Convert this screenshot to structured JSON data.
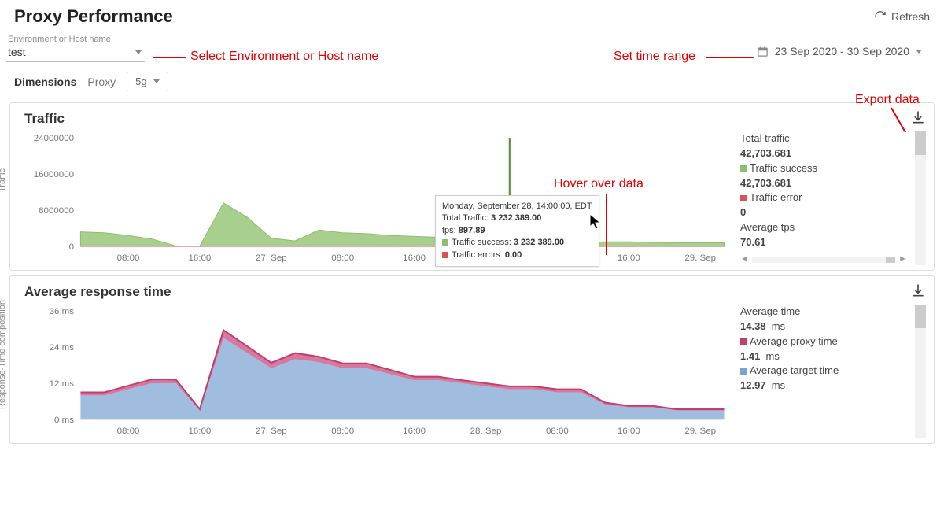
{
  "page": {
    "title": "Proxy Performance",
    "refresh": "Refresh"
  },
  "filters": {
    "env_label": "Environment or Host name",
    "env_value": "test",
    "date_range": "23 Sep 2020 - 30 Sep 2020"
  },
  "dimensions": {
    "label": "Dimensions",
    "proxy_label": "Proxy",
    "proxy_value": "5g"
  },
  "annotations": {
    "env": "Select Environment or Host name",
    "date": "Set time range",
    "hover": "Hover over data",
    "export": "Export data"
  },
  "traffic": {
    "title": "Traffic",
    "ylabel": "Traffic",
    "legend": {
      "total_label": "Total traffic",
      "total_value": "42,703,681",
      "success_label": "Traffic success",
      "success_value": "42,703,681",
      "error_label": "Traffic error",
      "error_value": "0",
      "tps_label": "Average tps",
      "tps_value": "70.61"
    },
    "tooltip": {
      "header": "Monday, September 28, 14:00:00, EDT",
      "total_label": "Total Traffic:",
      "total_value": "3 232 389.00",
      "tps_label": "tps:",
      "tps_value": "897.89",
      "success_label": "Traffic success:",
      "success_value": "3 232 389.00",
      "errors_label": "Traffic errors:",
      "errors_value": "0.00"
    }
  },
  "response": {
    "title": "Average response time",
    "ylabel": "Response-Time composition",
    "legend": {
      "avg_label": "Average time",
      "avg_value": "14.38",
      "avg_unit": "ms",
      "proxy_label": "Average proxy time",
      "proxy_value": "1.41",
      "proxy_unit": "ms",
      "target_label": "Average target time",
      "target_value": "12.97",
      "target_unit": "ms"
    }
  },
  "chart_data": [
    {
      "id": "traffic",
      "type": "area",
      "xlabel": "",
      "ylabel": "Traffic",
      "ylim": [
        0,
        24000000
      ],
      "yticks": [
        0,
        8000000,
        16000000,
        24000000
      ],
      "x_ticks": [
        "08:00",
        "16:00",
        "27. Sep",
        "08:00",
        "16:00",
        "28. Sep",
        "08:00",
        "16:00",
        "29. Sep"
      ],
      "x_index": [
        0,
        1,
        2,
        3,
        4,
        5,
        6,
        7,
        8,
        9,
        10,
        11,
        12,
        13,
        14,
        15,
        16,
        17,
        18,
        19,
        20,
        21,
        22,
        23,
        24,
        25,
        26,
        27
      ],
      "series": [
        {
          "name": "Traffic success",
          "color": "#8cbf6a",
          "values": [
            3200000,
            3000000,
            2400000,
            1600000,
            100000,
            50000,
            9600000,
            6400000,
            1800000,
            1200000,
            3600000,
            3000000,
            2800000,
            2400000,
            2200000,
            2000000,
            2000000,
            2000000,
            3232389,
            2000000,
            1000000,
            800000,
            1000000,
            1000000,
            900000,
            800000,
            800000,
            800000
          ]
        },
        {
          "name": "Traffic error",
          "color": "#d9534f",
          "values": [
            0,
            0,
            0,
            0,
            0,
            0,
            0,
            0,
            0,
            0,
            0,
            0,
            0,
            0,
            0,
            0,
            0,
            0,
            0,
            0,
            0,
            0,
            0,
            0,
            0,
            0,
            0,
            0
          ]
        }
      ],
      "hover_index": 18,
      "hover_point": {
        "timestamp": "Monday, September 28, 14:00:00, EDT",
        "total": 3232389.0,
        "tps": 897.89,
        "success": 3232389.0,
        "errors": 0.0
      }
    },
    {
      "id": "average_response_time",
      "type": "area",
      "xlabel": "",
      "ylabel": "Response-Time composition (ms)",
      "ylim": [
        0,
        36
      ],
      "yticks": [
        0,
        12,
        24,
        36
      ],
      "yticks_labels": [
        "0 ms",
        "12 ms",
        "24 ms",
        "36 ms"
      ],
      "x_ticks": [
        "08:00",
        "16:00",
        "27. Sep",
        "08:00",
        "16:00",
        "28. Sep",
        "08:00",
        "16:00",
        "29. Sep"
      ],
      "x_index": [
        0,
        1,
        2,
        3,
        4,
        5,
        6,
        7,
        8,
        9,
        10,
        11,
        12,
        13,
        14,
        15,
        16,
        17,
        18,
        19,
        20,
        21,
        22,
        23,
        24,
        25,
        26,
        27
      ],
      "series": [
        {
          "name": "Average proxy time",
          "color": "#c23f6d",
          "values": [
            1.0,
            1.0,
            1.2,
            1.3,
            1.2,
            0.4,
            2.6,
            2.2,
            1.8,
            2.0,
            1.8,
            1.6,
            1.6,
            1.4,
            1.2,
            1.2,
            1.0,
            1.0,
            1.0,
            1.0,
            1.0,
            1.0,
            0.6,
            0.5,
            0.5,
            0.4,
            0.4,
            0.4
          ]
        },
        {
          "name": "Average target time",
          "color": "#7aa3d1",
          "values": [
            8.0,
            8.0,
            10.0,
            12.0,
            12.0,
            3.0,
            27.0,
            22.0,
            17.0,
            20.0,
            19.0,
            17.0,
            17.0,
            15.0,
            13.0,
            13.0,
            12.0,
            11.0,
            10.0,
            10.0,
            9.0,
            9.0,
            5.0,
            4.0,
            4.0,
            3.0,
            3.0,
            3.0
          ]
        }
      ],
      "total_series": {
        "name": "Average time",
        "values": [
          9.0,
          9.0,
          11.2,
          13.3,
          13.2,
          3.4,
          29.6,
          24.2,
          18.8,
          22.0,
          20.8,
          18.6,
          18.6,
          16.4,
          14.2,
          14.2,
          13.0,
          12.0,
          11.0,
          11.0,
          10.0,
          10.0,
          5.6,
          4.5,
          4.5,
          3.4,
          3.4,
          3.4
        ]
      }
    }
  ],
  "colors": {
    "success": "#8cbf6a",
    "error": "#d9534f",
    "proxy": "#c23f6d",
    "target": "#7aa3d1",
    "ann": "#e60000"
  }
}
